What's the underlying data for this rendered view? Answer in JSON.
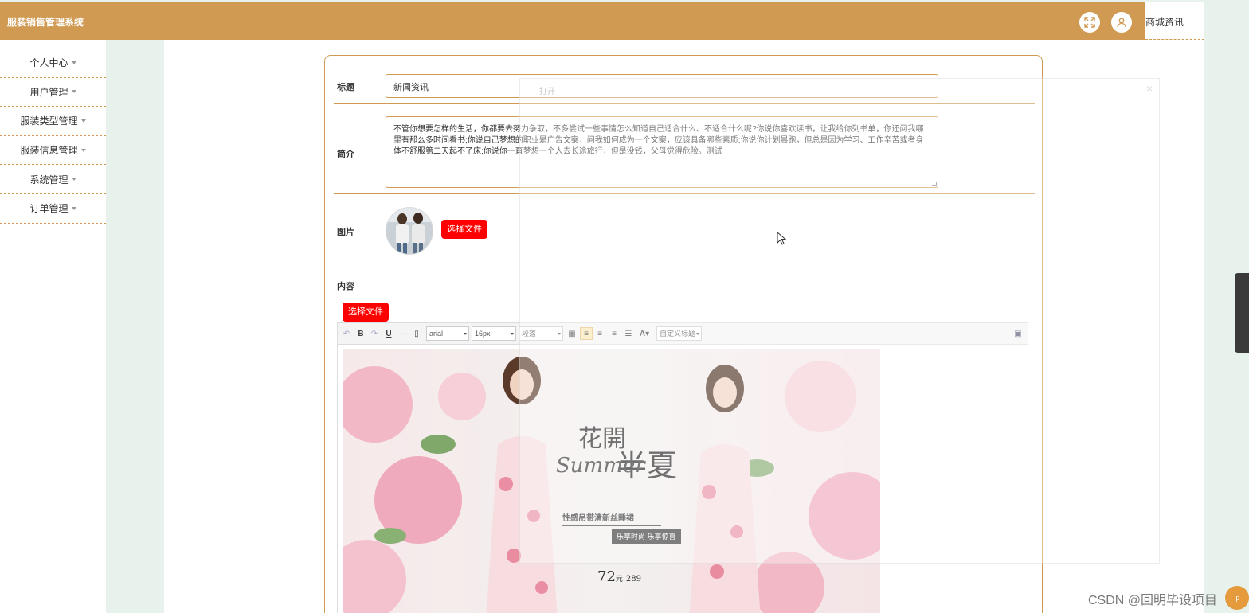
{
  "header": {
    "title": "服装销售管理系统",
    "right_link": "商城资讯",
    "fullscreen_icon": "fullscreen-icon",
    "user_icon": "user-icon",
    "color": "#d09a52"
  },
  "sidebar": {
    "items": [
      {
        "label": "个人中心"
      },
      {
        "label": "用户管理"
      },
      {
        "label": "服装类型管理"
      },
      {
        "label": "服装信息管理"
      },
      {
        "label": "系统管理"
      },
      {
        "label": "订单管理"
      }
    ]
  },
  "form": {
    "title_label": "标题",
    "title_value": "新闻资讯",
    "intro_label": "简介",
    "intro_value": "不管你想要怎样的生活，你都要去努力争取，不多尝试一些事情怎么知道自己适合什么、不适合什么呢?你说你喜欢读书，让我给你列书单，你还问我哪里有那么多时间看书;你说自己梦想的职业是广告文案，问我如何成为一个文案，应该具备哪些素质;你说你计划晨跑，但总是因为学习、工作辛苦或者身体不舒服第二天起不了床;你说你一直梦想一个人去长途旅行，但是没钱，父母觉得危险。测试",
    "image_label": "图片",
    "choose_file": "选择文件",
    "content_label": "内容",
    "content_choose_file": "选择文件"
  },
  "editor": {
    "font_family": "arial",
    "font_size": "16px",
    "paragraph": "段落",
    "custom_title": "自定义标题",
    "font_color_glyph": "A",
    "banner": {
      "cn_title_1": "花開",
      "cn_title_2": "半夏",
      "en_title": "Summer",
      "tagline": "性感吊带清新丝睡裙",
      "sub": "乐享时尚 乐享惊喜",
      "price": "72",
      "price_unit": "元",
      "price_old": "289"
    }
  },
  "overlay": {
    "title": "打开"
  },
  "watermark": "CSDN @回明毕设项目",
  "help_badge": "ip"
}
